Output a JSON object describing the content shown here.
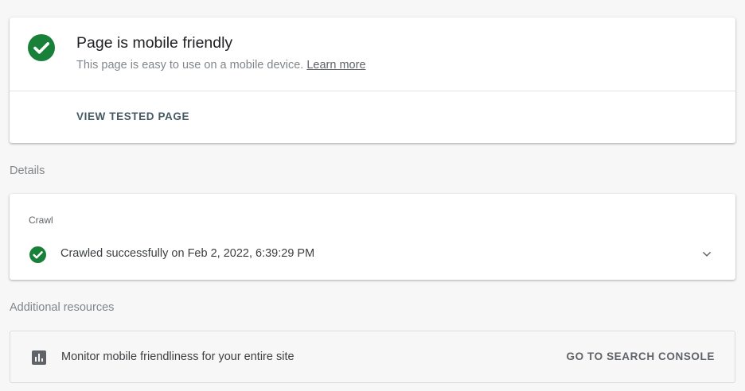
{
  "result": {
    "title": "Page is mobile friendly",
    "subtitle": "This page is easy to use on a mobile device.",
    "learn_more": "Learn more",
    "view_button": "VIEW TESTED PAGE",
    "status_color": "#188038",
    "icon": "check-circle-icon"
  },
  "details": {
    "label": "Details",
    "crawl": {
      "heading": "Crawl",
      "status_text": "Crawled successfully on Feb 2, 2022, 6:39:29 PM",
      "icon": "check-circle-icon",
      "expand_icon": "chevron-down-icon"
    }
  },
  "resources": {
    "label": "Additional resources",
    "item_text": "Monitor mobile friendliness for your entire site",
    "item_icon": "bar-chart-icon",
    "button": "GO TO SEARCH CONSOLE"
  }
}
